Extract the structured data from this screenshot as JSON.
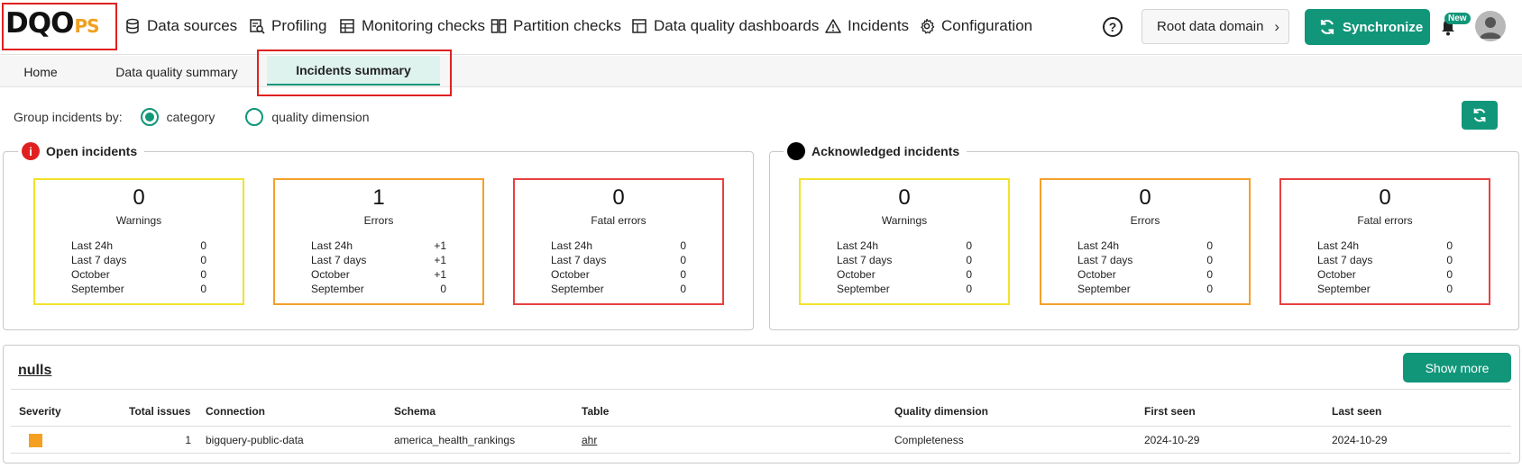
{
  "app": {
    "logo_main": "DQO",
    "logo_suffix": "PS"
  },
  "nav": {
    "items": [
      {
        "label": "Data sources",
        "icon": "database-icon"
      },
      {
        "label": "Profiling",
        "icon": "profiling-icon"
      },
      {
        "label": "Monitoring checks",
        "icon": "monitoring-icon"
      },
      {
        "label": "Partition checks",
        "icon": "partition-icon"
      },
      {
        "label": "Data quality dashboards",
        "icon": "dashboard-icon"
      },
      {
        "label": "Incidents",
        "icon": "warning-icon"
      },
      {
        "label": "Configuration",
        "icon": "gear-icon"
      }
    ],
    "help_label": "?",
    "domain_label": "Root data domain",
    "sync_label": "Synchronize",
    "new_badge": "New"
  },
  "tabs": [
    {
      "label": "Home",
      "active": false
    },
    {
      "label": "Data quality summary",
      "active": false
    },
    {
      "label": "Incidents summary",
      "active": true
    }
  ],
  "groupby": {
    "label": "Group incidents by:",
    "options": [
      {
        "label": "category",
        "selected": true
      },
      {
        "label": "quality dimension",
        "selected": false
      }
    ]
  },
  "open_incidents": {
    "title": "Open incidents",
    "cards": [
      {
        "count": "0",
        "label": "Warnings",
        "rows": [
          [
            "Last 24h",
            "0"
          ],
          [
            "Last 7 days",
            "0"
          ],
          [
            "October",
            "0"
          ],
          [
            "September",
            "0"
          ]
        ]
      },
      {
        "count": "1",
        "label": "Errors",
        "rows": [
          [
            "Last 24h",
            "+1"
          ],
          [
            "Last 7 days",
            "+1"
          ],
          [
            "October",
            "+1"
          ],
          [
            "September",
            "0"
          ]
        ]
      },
      {
        "count": "0",
        "label": "Fatal errors",
        "rows": [
          [
            "Last 24h",
            "0"
          ],
          [
            "Last 7 days",
            "0"
          ],
          [
            "October",
            "0"
          ],
          [
            "September",
            "0"
          ]
        ]
      }
    ]
  },
  "ack_incidents": {
    "title": "Acknowledged incidents",
    "cards": [
      {
        "count": "0",
        "label": "Warnings",
        "rows": [
          [
            "Last 24h",
            "0"
          ],
          [
            "Last 7 days",
            "0"
          ],
          [
            "October",
            "0"
          ],
          [
            "September",
            "0"
          ]
        ]
      },
      {
        "count": "0",
        "label": "Errors",
        "rows": [
          [
            "Last 24h",
            "0"
          ],
          [
            "Last 7 days",
            "0"
          ],
          [
            "October",
            "0"
          ],
          [
            "September",
            "0"
          ]
        ]
      },
      {
        "count": "0",
        "label": "Fatal errors",
        "rows": [
          [
            "Last 24h",
            "0"
          ],
          [
            "Last 7 days",
            "0"
          ],
          [
            "October",
            "0"
          ],
          [
            "September",
            "0"
          ]
        ]
      }
    ]
  },
  "nulls": {
    "title": "nulls",
    "show_more": "Show more",
    "headers": [
      "Severity",
      "Total issues",
      "Connection",
      "Schema",
      "Table",
      "Quality dimension",
      "First seen",
      "Last seen"
    ],
    "rows": [
      {
        "severity_color": "#f5a020",
        "total": "1",
        "connection": "bigquery-public-data",
        "schema": "america_health_rankings",
        "table": "ahr",
        "dimension": "Completeness",
        "first_seen": "2024-10-29",
        "last_seen": "2024-10-29"
      }
    ]
  },
  "colors": {
    "accent": "#11967a",
    "warning": "#f2e22a",
    "error": "#f5a02a",
    "fatal": "#e84040",
    "highlight": "#e02020"
  }
}
